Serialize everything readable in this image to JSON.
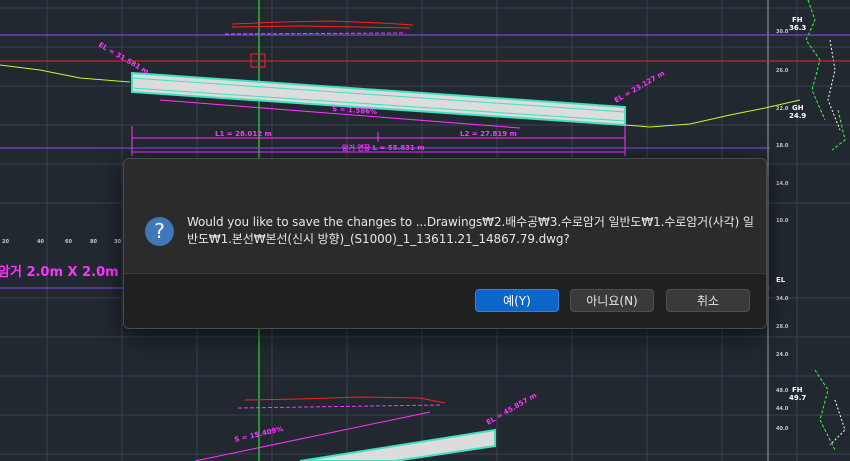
{
  "drawing": {
    "annotations": {
      "slope_top_left": "EL = 31.581 m",
      "slope_top_right": "EL = 23.127 m",
      "slope_label": "S = 1.586%",
      "l1": "L1 = 28.012 m",
      "l2": "L2 = 27.819 m",
      "total": "암거 연장 L = 55.831 m",
      "culvert_size": "암거 2.0m X 2.0m",
      "slope_bottom_label": "S = 15.409%",
      "slope_bottom_right": "EL = 45.857 m"
    },
    "left_ticks": [
      "20",
      "40",
      "60",
      "80",
      "30"
    ],
    "right_labels": {
      "fh_top": "FH",
      "fh_top_val": "36.3",
      "gh_mid": "GH",
      "gh_mid_val": "24.9",
      "el_mid": "EL",
      "fh_bottom": "FH",
      "fh_bottom_val": "49.7"
    },
    "right_scale": [
      "30.0",
      "26.0",
      "22.0",
      "18.0",
      "14.0",
      "10.0",
      "34.0",
      "28.0",
      "24.0",
      "48.0",
      "44.0",
      "40.0"
    ]
  },
  "dialog": {
    "icon": "question-icon",
    "message": "Would you like to save the changes to ...Drawings₩2.배수공₩3.수로암거 일반도₩1.수로암거(사각) 일반도₩1.본선₩본선(신시 방향)_(S1000)_1_13611.21_14867.79.dwg?",
    "buttons": {
      "yes": "예(Y)",
      "no": "아니요(N)",
      "cancel": "취소"
    }
  },
  "colors": {
    "background": "#212830",
    "grid": "#3a4250",
    "magenta": "#ff33ff",
    "red": "#ff2020",
    "green": "#33ff33",
    "lime": "#b8ff2e",
    "cyan": "#40e0c0",
    "purple": "#8c4cff",
    "yes_button": "#0b66c8"
  }
}
